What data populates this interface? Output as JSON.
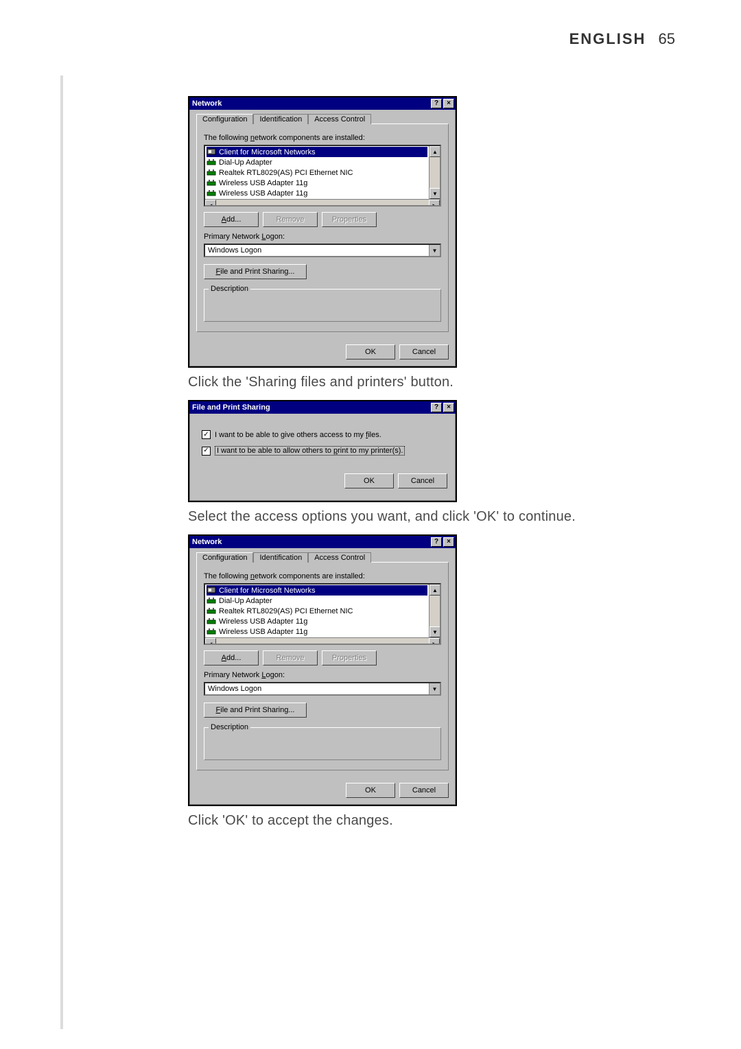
{
  "header": {
    "lang": "ENGLISH",
    "page": "65"
  },
  "captions": {
    "c1": "Click the 'Sharing files and printers' button.",
    "c2": "Select the access options you want, and click 'OK' to continue.",
    "c3": "Click 'OK' to accept the changes."
  },
  "network_dialog": {
    "title": "Network",
    "tabs": {
      "active": "Configuration",
      "t2": "Identification",
      "t3": "Access Control"
    },
    "list_label_prefix": "The following ",
    "list_label_accel": "n",
    "list_label_suffix": "etwork components are installed:",
    "items": [
      "Client for Microsoft Networks",
      "Dial-Up Adapter",
      "Realtek RTL8029(AS) PCI Ethernet NIC",
      "Wireless USB Adapter 11g",
      "Wireless USB Adapter 11g"
    ],
    "add": "Add...",
    "remove": "Remove",
    "properties": "Properties",
    "logon_label_prefix": "Primary Network ",
    "logon_label_accel": "L",
    "logon_label_suffix": "ogon:",
    "logon_value": "Windows Logon",
    "fps_prefix": "",
    "fps_accel": "F",
    "fps_suffix": "ile and Print Sharing...",
    "description_title": "Description",
    "ok": "OK",
    "cancel": "Cancel"
  },
  "fps_dialog": {
    "title": "File and Print Sharing",
    "cb1_prefix": "I want to be able to give others access to my ",
    "cb1_accel": "f",
    "cb1_suffix": "iles.",
    "cb2_prefix": "I want to be able to allow others to ",
    "cb2_accel": "p",
    "cb2_suffix": "rint to my printer(s).",
    "ok": "OK",
    "cancel": "Cancel"
  }
}
